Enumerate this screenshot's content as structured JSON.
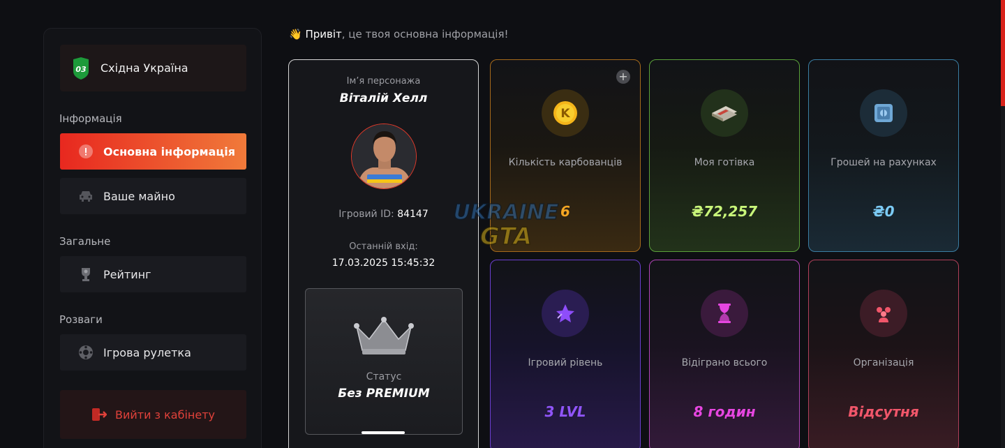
{
  "server": {
    "badge": "03",
    "name": "Східна Україна"
  },
  "sidebar": {
    "sections": [
      {
        "label": "Інформація"
      },
      {
        "label": "Загальне"
      },
      {
        "label": "Розваги"
      }
    ],
    "items": [
      {
        "label": "Основна інформація",
        "icon": "alert-circle-icon"
      },
      {
        "label": "Ваше майно",
        "icon": "car-icon"
      },
      {
        "label": "Рейтинг",
        "icon": "trophy-icon"
      },
      {
        "label": "Ігрова рулетка",
        "icon": "roulette-icon"
      }
    ],
    "logout": {
      "label": "Вийти з кабінету",
      "icon": "logout-icon"
    }
  },
  "greeting": {
    "emoji": "👋",
    "hello": "Привіт",
    "rest": ", це твоя основна інформація!"
  },
  "profile": {
    "name_label": "Ім’я персонажа",
    "name": "Віталій Хелл",
    "id_label": "Ігровий ID:",
    "id_value": "84147",
    "last_login_label": "Останній вхід:",
    "last_login": "17.03.2025 15:45:32",
    "status_label": "Статус",
    "status_value": "Без PREMIUM"
  },
  "cards": [
    {
      "label": "Кількість карбованців",
      "value": "6",
      "icon": "karbovanets-coin-icon",
      "color": "#f5a623"
    },
    {
      "label": "Моя готівка",
      "value": "₴72,257",
      "icon": "cash-stack-icon",
      "color": "#b7f56a"
    },
    {
      "label": "Грошей на рахунках",
      "value": "₴0",
      "icon": "safe-icon",
      "color": "#6ec6f5"
    },
    {
      "label": "Ігровий рівень",
      "value": "3 LVL",
      "icon": "star-icon",
      "color": "#8f4dfa"
    },
    {
      "label": "Відіграно всього",
      "value": "8 годин",
      "icon": "hourglass-icon",
      "color": "#e646e0"
    },
    {
      "label": "Організація",
      "value": "Відсутня",
      "icon": "group-icon",
      "color": "#f0566a"
    }
  ],
  "watermark": {
    "line1": "UKRAINE",
    "line2": "GTA"
  }
}
